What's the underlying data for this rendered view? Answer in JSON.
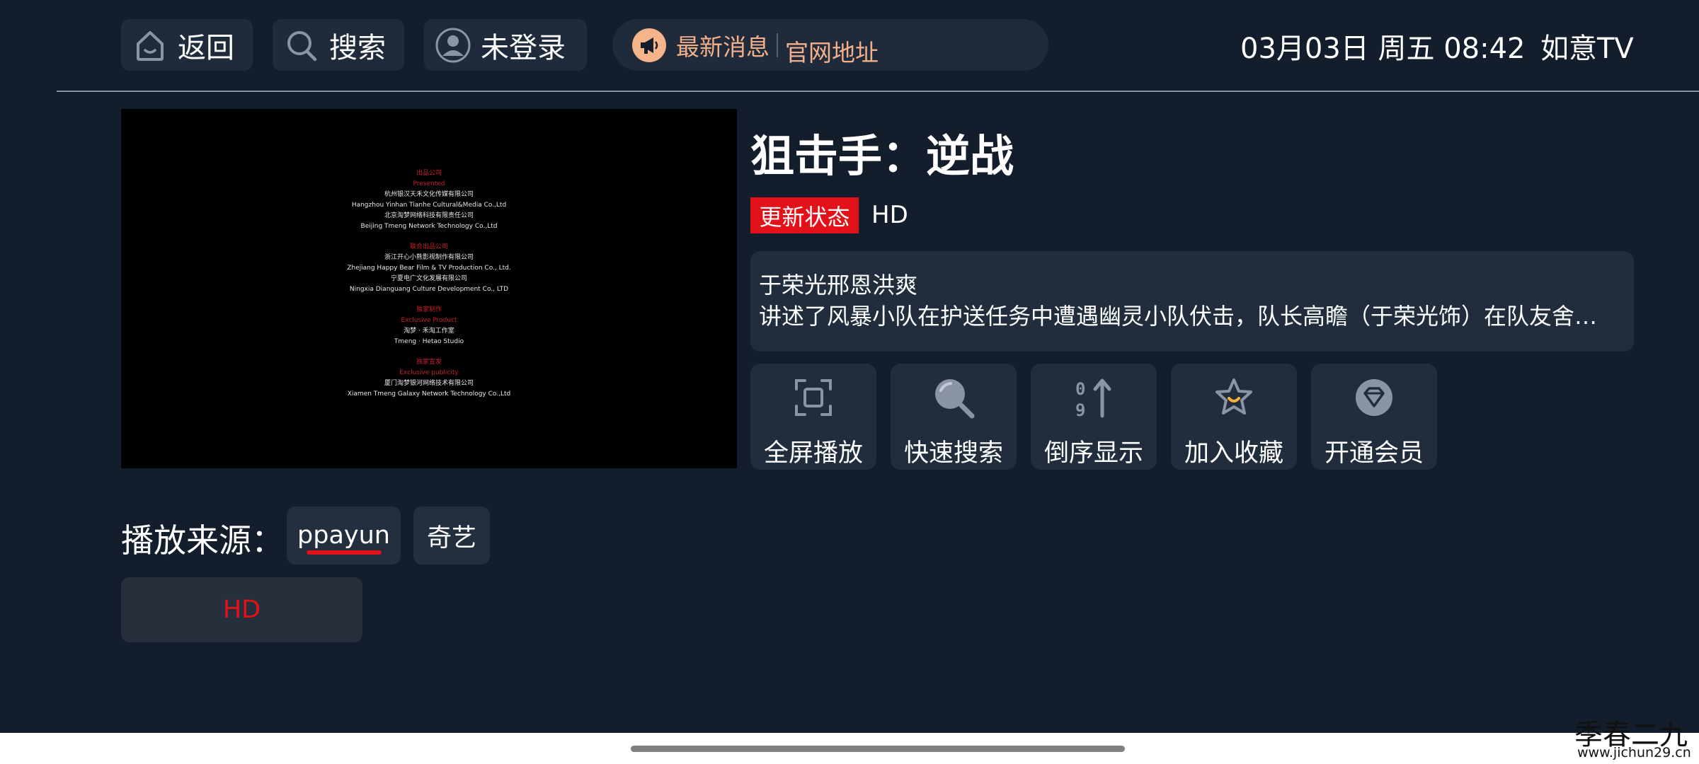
{
  "topbar": {
    "back_label": "返回",
    "search_label": "搜索",
    "login_label": "未登录",
    "news_label": "最新消息",
    "news_link": "官网地址",
    "datetime": "03月03日 周五 08:42",
    "brand": "如意TV"
  },
  "video": {
    "credits": [
      {
        "text": "出品公司",
        "red": true
      },
      {
        "text": "Presented",
        "red": true
      },
      {
        "text": "杭州银汉天禾文化传媒有限公司",
        "red": false
      },
      {
        "text": "Hangzhou Yinhan Tianhe Cultural&Media Co.,Ltd",
        "red": false
      },
      {
        "text": "北京淘梦网络科技有限责任公司",
        "red": false
      },
      {
        "text": "Beijing Tmeng Network Technology Co.,Ltd",
        "red": false
      },
      {
        "text": "",
        "red": false
      },
      {
        "text": "联合出品公司",
        "red": true
      },
      {
        "text": "浙江开心小熊影视制作有限公司",
        "red": false
      },
      {
        "text": "Zhejiang Happy Bear Film & TV Production Co., Ltd.",
        "red": false
      },
      {
        "text": "宁夏电广文化发展有限公司",
        "red": false
      },
      {
        "text": "Ningxia Dianguang Culture Development Co., LTD",
        "red": false
      },
      {
        "text": "",
        "red": false
      },
      {
        "text": "独家制作",
        "red": true
      },
      {
        "text": "Exclusive Product",
        "red": true
      },
      {
        "text": "淘梦 · 禾淘工作室",
        "red": false
      },
      {
        "text": "Tmeng · Hetao Studio",
        "red": false
      },
      {
        "text": "",
        "red": false
      },
      {
        "text": "独家宣发",
        "red": true
      },
      {
        "text": "Exclusive publicity",
        "red": true
      },
      {
        "text": "厦门淘梦银河网络技术有限公司",
        "red": false
      },
      {
        "text": "Xiamen Tmeng Galaxy Network Technology Co.,Ltd",
        "red": false
      }
    ]
  },
  "detail": {
    "title": "狙击手：逆战",
    "status_badge": "更新状态",
    "quality": "HD",
    "cast": "于荣光邢恩洪爽",
    "synopsis": "讲述了风暴小队在护送任务中遭遇幽灵小队伏击，队长高瞻（于荣光饰）在队友舍…"
  },
  "actions": {
    "fullscreen": "全屏播放",
    "quicksearch": "快速搜索",
    "reverse": "倒序显示",
    "favorite": "加入收藏",
    "vip": "开通会员"
  },
  "sources": {
    "label": "播放来源：",
    "items": [
      "ppayun",
      "奇艺"
    ],
    "selected": "ppayun"
  },
  "episodes": [
    "HD"
  ],
  "watermark": {
    "line1": "季春二九",
    "line2": "www.jichun29.cn"
  },
  "colors": {
    "background": "#131d2c",
    "panel": "#212c3c",
    "accent_red": "#e3121a",
    "news_orange": "#f4b08a"
  }
}
